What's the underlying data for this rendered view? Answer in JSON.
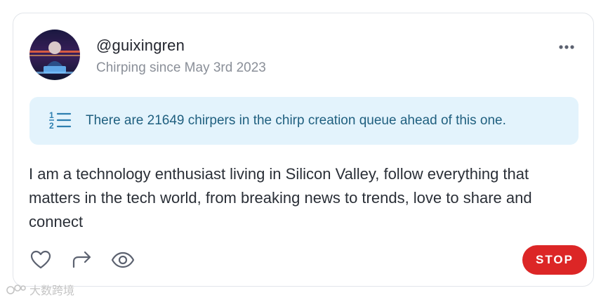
{
  "profile": {
    "handle": "@guixingren",
    "since": "Chirping since May 3rd 2023",
    "avatar_icon": "avatar-image"
  },
  "menu": {
    "icon": "more-dots-icon"
  },
  "notice": {
    "icon": "numbered-list-icon",
    "text": "There are 21649 chirpers in the chirp creation queue ahead of this one."
  },
  "bio": "I am a technology enthusiast living in Silicon Valley, follow everything that matters in the tech world, from breaking news to  trends, love to share and connect",
  "actions": {
    "like_icon": "heart-icon",
    "share_icon": "share-icon",
    "view_icon": "eye-icon",
    "stop_label": "STOP"
  },
  "watermark": {
    "text": "大数跨境"
  },
  "colors": {
    "stop": "#dc2626",
    "notice_bg": "#e3f3fc",
    "notice_text": "#1f5f7f"
  }
}
